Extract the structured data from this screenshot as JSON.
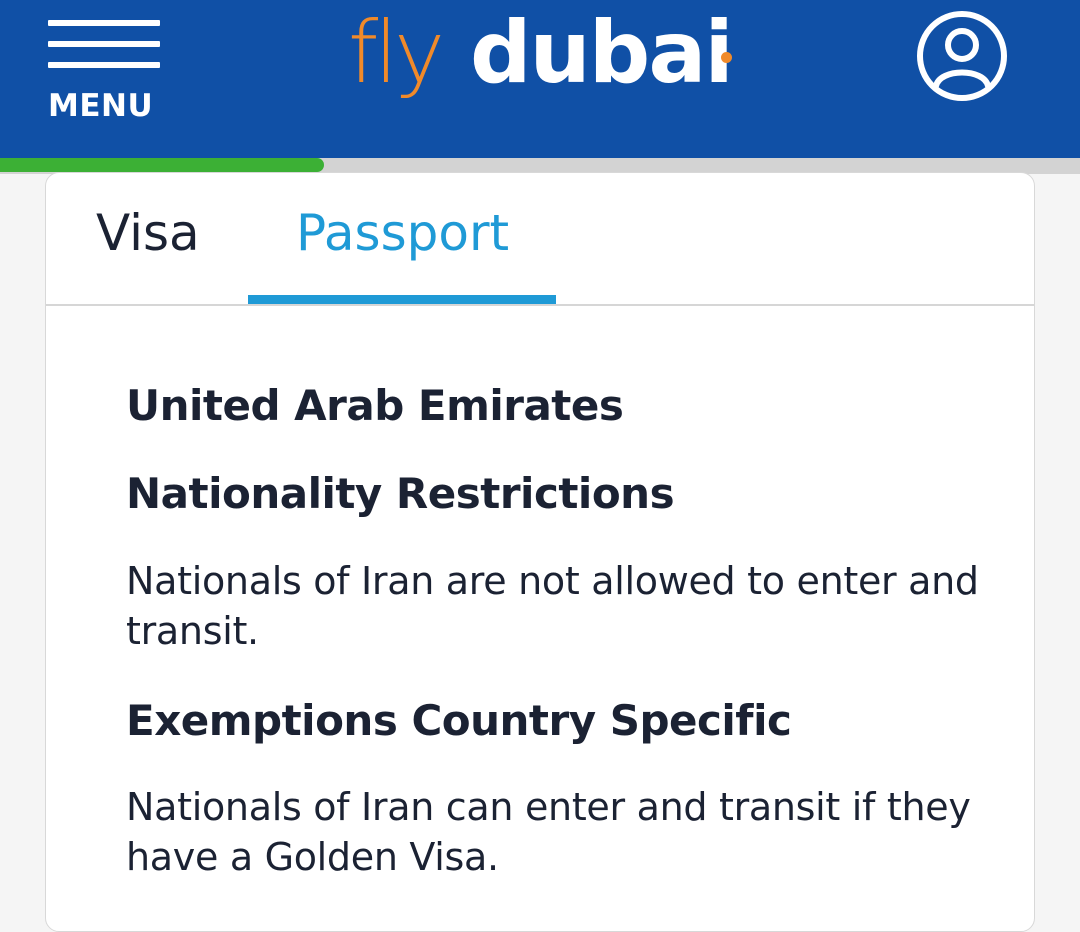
{
  "header": {
    "menu_label": "MENU",
    "logo_fly": "fly",
    "logo_dubai": "dubai",
    "brand_color": "#1050a6",
    "logo_accent_color": "#f08a2a",
    "account_icon": "user-icon"
  },
  "progress": {
    "fraction": 0.3
  },
  "tabs": [
    {
      "label": "Visa",
      "active": false
    },
    {
      "label": "Passport",
      "active": true
    }
  ],
  "content": {
    "country": "United Arab Emirates",
    "sections": [
      {
        "title": "Nationality Restrictions",
        "text": "Nationals of Iran are not allowed to enter and transit."
      },
      {
        "title": "Exemptions Country Specific",
        "text": "Nationals of Iran can enter and transit if they have a Golden Visa."
      }
    ]
  },
  "colors": {
    "active_tab": "#1f9ad6",
    "progress": "#3cb035",
    "text": "#1b2233"
  }
}
